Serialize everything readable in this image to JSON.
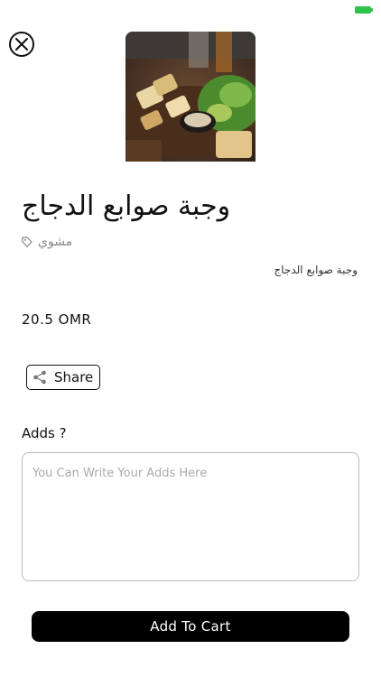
{
  "status_bar": {
    "battery_color": "#2fc24d"
  },
  "product": {
    "title": "وجبة صوابع الدجاج",
    "category": "مشوي",
    "description": "وجبة صوابع الدجاج",
    "price": "20.5 OMR",
    "image": "grilled-chicken-skewers-salad-photo"
  },
  "actions": {
    "share_label": "Share",
    "add_to_cart_label": "Add To Cart"
  },
  "adds": {
    "label": "Adds ?",
    "placeholder": "You Can Write Your Adds Here",
    "value": ""
  },
  "colors": {
    "primary": "#000000",
    "muted": "#888888",
    "border": "#bbbbbb"
  }
}
